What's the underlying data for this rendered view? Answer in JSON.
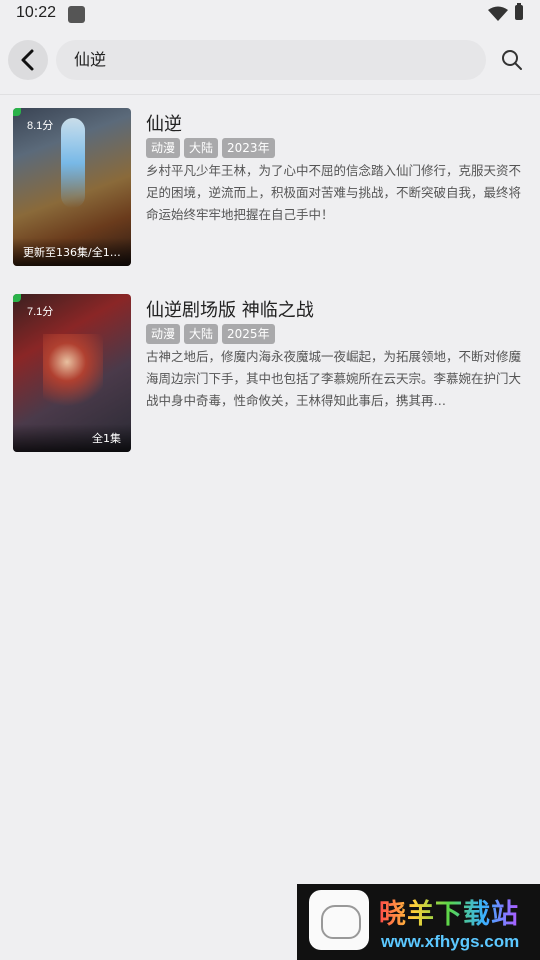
{
  "status": {
    "time": "10:22"
  },
  "search": {
    "query": "仙逆"
  },
  "results": [
    {
      "title": "仙逆",
      "rating": "8.1分",
      "caption": "更新至136集/全1…",
      "tags": [
        "动漫",
        "大陆",
        "2023年"
      ],
      "description": "乡村平凡少年王林，为了心中不屈的信念踏入仙门修行，克服天资不足的困境，逆流而上，积极面对苦难与挑战，不断突破自我，最终将命运始终牢牢地把握在自己手中！"
    },
    {
      "title": "仙逆剧场版 神临之战",
      "rating": "7.1分",
      "caption": "全1集",
      "tags": [
        "动漫",
        "大陆",
        "2025年"
      ],
      "description": "古神之地后，修魔内海永夜魔城一夜崛起，为拓展领地，不断对修魔海周边宗门下手，其中也包括了李慕婉所在云天宗。李慕婉在护门大战中身中奇毒，性命攸关，王林得知此事后，携其再…"
    }
  ],
  "watermark": {
    "title": "晓羊下载站",
    "url": "www.xfhygs.com"
  },
  "icons": {
    "back": "back-arrow-icon",
    "search": "search-icon",
    "wifi": "wifi-icon",
    "battery": "battery-icon"
  },
  "colors": {
    "tag_bg": "#a9a9ab",
    "background": "#efeff1"
  }
}
